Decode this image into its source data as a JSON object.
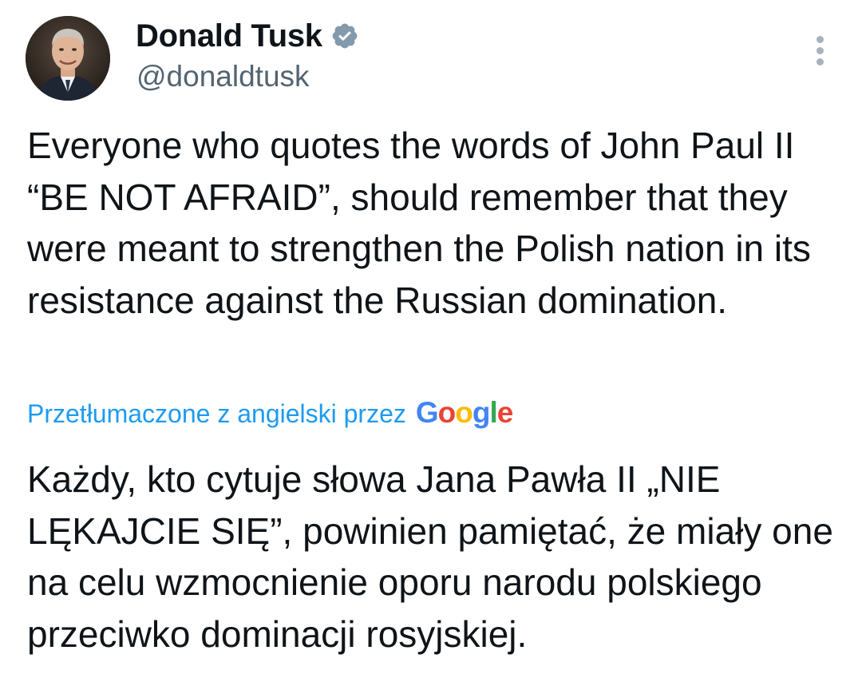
{
  "author": {
    "display_name": "Donald Tusk",
    "handle": "@donaldtusk",
    "verified_icon": "verified-badge-icon",
    "avatar_icon": "profile-photo"
  },
  "menu": {
    "icon": "more-vertical-icon"
  },
  "tweet": {
    "text": "Everyone who quotes the words of John Paul II “BE NOT AFRAID”, should remember that they were meant to strengthen the Polish nation in its resistance against the Russian domination."
  },
  "translation": {
    "label": "Przetłumaczone z angielski przez",
    "provider": [
      "G",
      "o",
      "o",
      "g",
      "l",
      "e"
    ],
    "text": "Każdy, kto cytuje słowa Jana Pawła II „NIE LĘKAJCIE SIĘ”, powinien pamiętać, że miały one na celu wzmocnienie oporu narodu polskiego przeciwko dominacji rosyjskiej."
  },
  "colors": {
    "link": "#1d9bf0",
    "text": "#0f1419",
    "secondary": "#536471",
    "verified": "#829aab"
  }
}
